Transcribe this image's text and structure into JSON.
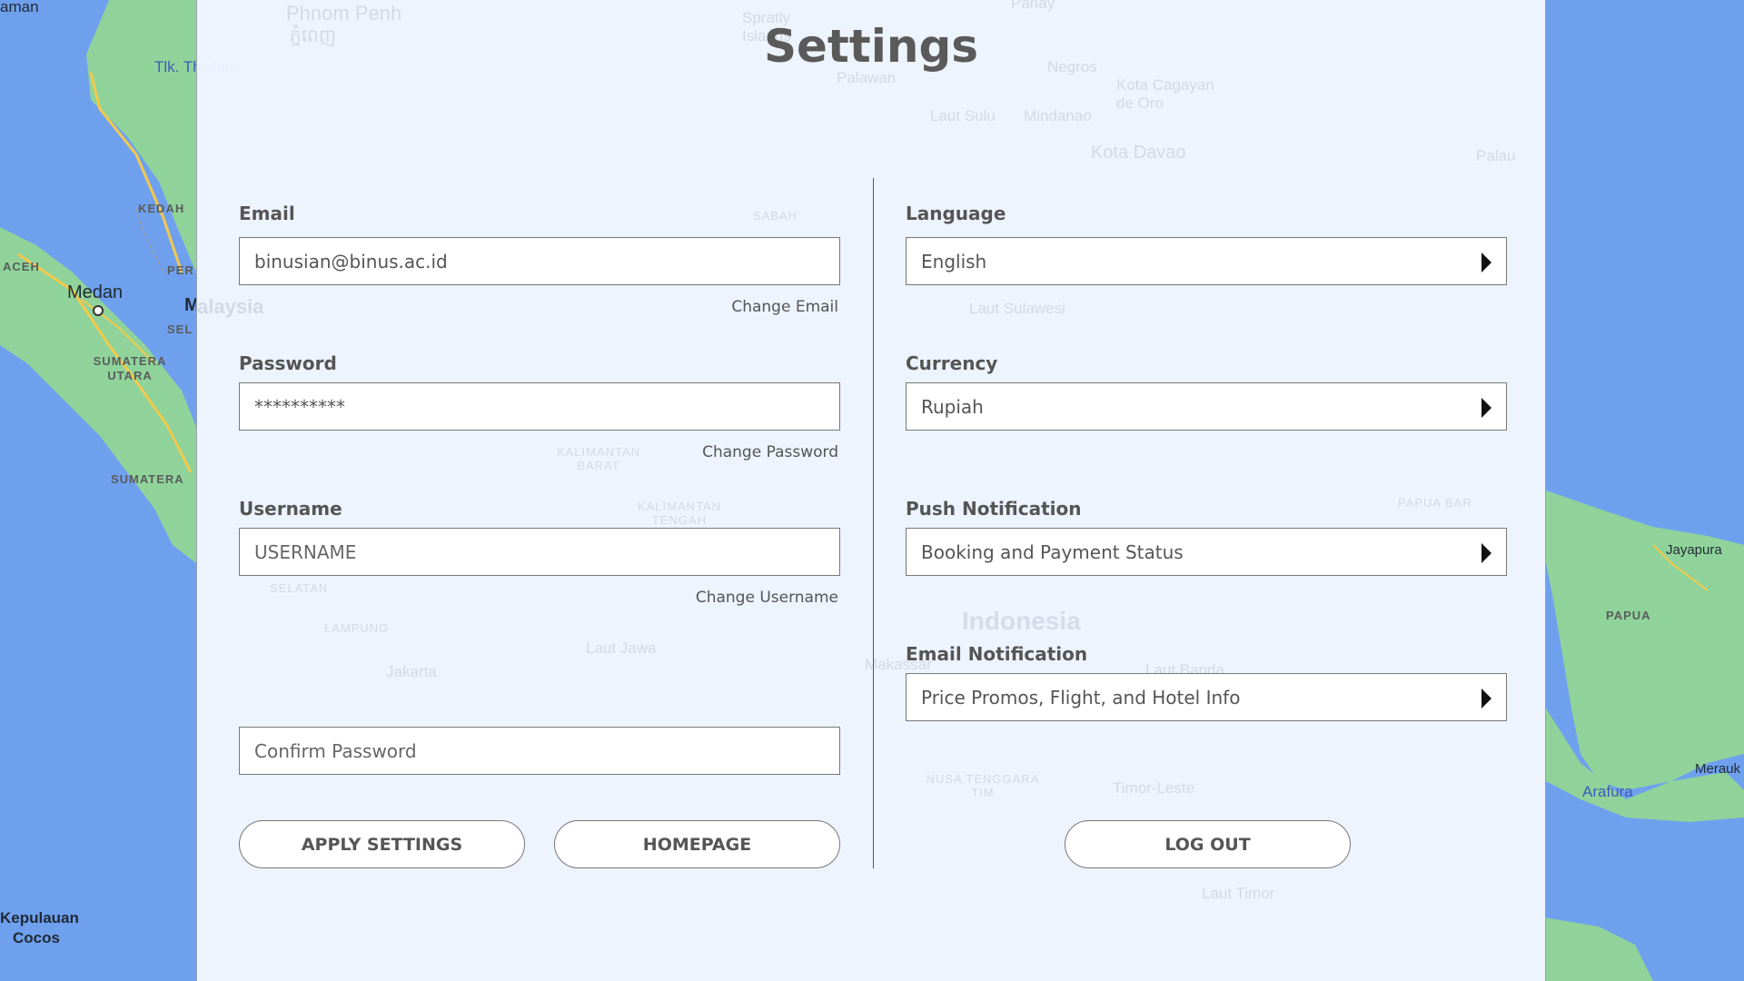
{
  "title": "Settings",
  "map_labels": {
    "andaman": "aman",
    "tlk_thailand": "Tlk. Thailand",
    "kedah": "KEDAH",
    "aceh": "ACEH",
    "medan": "Medan",
    "malaysia_m": "M",
    "perak": "PER",
    "selangor": "SEL",
    "sumatera_utara": "SUMATERA UTARA",
    "sumatera_barat": "SUMATERA",
    "kepulauan_cocos": "Kepulauan Cocos",
    "jayapura": "Jayapura",
    "papua": "PAPUA",
    "merauke": "Merauk",
    "arafura": "Arafura"
  },
  "panel_background_labels": {
    "phnom_penh": "Phnom Penh",
    "phnom_penh_khmer": "ភ្នំពេញ",
    "spratly": "Spratly Islands",
    "palawan": "Palawan",
    "negros": "Negros",
    "laut_sulu": "Laut Sulu",
    "mindanao": "Mindanao",
    "cagayan": "Kota Cagayan de Oro",
    "davao": "Kota Davao",
    "palau": "Palau",
    "panay": "Panay",
    "malaysia": "alaysia",
    "sabah": "SABAH",
    "kalimantan_barat": "KALIMANTAN BARAT",
    "kalimantan_tengah": "KALIMANTAN TENGAH",
    "laut_sulawesi": "Laut Sulawesi",
    "papua_barat": "PAPUA BAR",
    "indonesia": "Indonesia",
    "laut_jawa": "Laut Jawa",
    "lampung": "LAMPUNG",
    "jakarta": "Jakarta",
    "makassar": "Makassar",
    "laut_banda": "Laut Banda",
    "nusa_tenggara": "NUSA TENGGARA TIM",
    "timor_leste": "Timor-Leste",
    "laut_timor": "Laut Timor",
    "selatan": "SELATAN"
  },
  "colors": {
    "ocean": "#6fa0ee",
    "land": "#8fd39a",
    "road": "#f2c94c",
    "panel": "#f5f9ff"
  },
  "left_form": {
    "email": {
      "label": "Email",
      "value": "binusian@binus.ac.id",
      "link": "Change Email"
    },
    "password": {
      "label": "Password",
      "value": "**********",
      "link": "Change Password"
    },
    "username": {
      "label": "Username",
      "placeholder": "USERNAME",
      "link": "Change Username"
    },
    "confirm_password": {
      "placeholder": "Confirm Password"
    },
    "apply_button": "APPLY SETTINGS",
    "homepage_button": "HOMEPAGE"
  },
  "right_form": {
    "language": {
      "label": "Language",
      "value": "English"
    },
    "currency": {
      "label": "Currency",
      "value": "Rupiah"
    },
    "push_notification": {
      "label": "Push Notification",
      "value": "Booking and Payment Status"
    },
    "email_notification": {
      "label": "Email Notification",
      "value": "Price Promos, Flight, and Hotel Info"
    },
    "logout_button": "LOG OUT"
  }
}
